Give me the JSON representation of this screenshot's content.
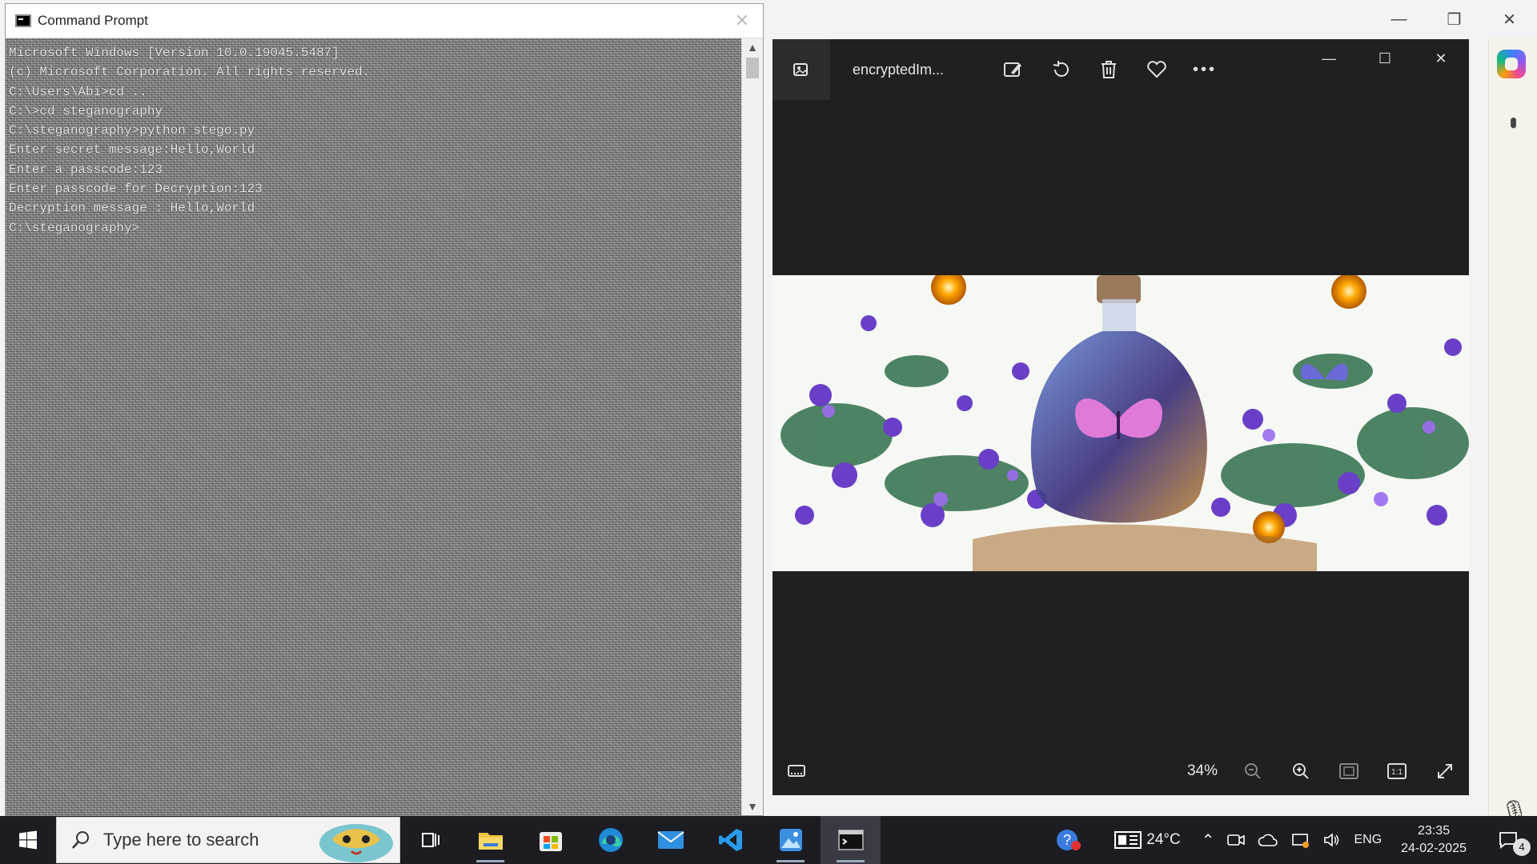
{
  "cmd": {
    "title": "Command Prompt",
    "lines": [
      "Microsoft Windows [Version 10.0.19045.5487]",
      "(c) Microsoft Corporation. All rights reserved.",
      "",
      "C:\\Users\\Abi>cd ..",
      "",
      "C:\\>cd steganography",
      "",
      "C:\\steganography>python stego.py",
      "Enter secret message:Hello,World",
      "Enter a passcode:123",
      "Enter passcode for Decryption:123",
      "Decryption message : Hello,World",
      "",
      "C:\\steganography>"
    ]
  },
  "photos": {
    "filename": "encryptedIm...",
    "zoom": "34%",
    "toolbar": [
      "edit-image",
      "rotate",
      "delete",
      "favorite",
      "more"
    ]
  },
  "taskbar": {
    "search_placeholder": "Type here to search",
    "apps": [
      "task-view",
      "file-explorer",
      "microsoft-store",
      "edge",
      "mail",
      "vs-code",
      "photos",
      "command-prompt"
    ],
    "weather": "24°C",
    "language": "ENG",
    "time": "23:35",
    "date": "24-02-2025",
    "notifications": "4"
  }
}
